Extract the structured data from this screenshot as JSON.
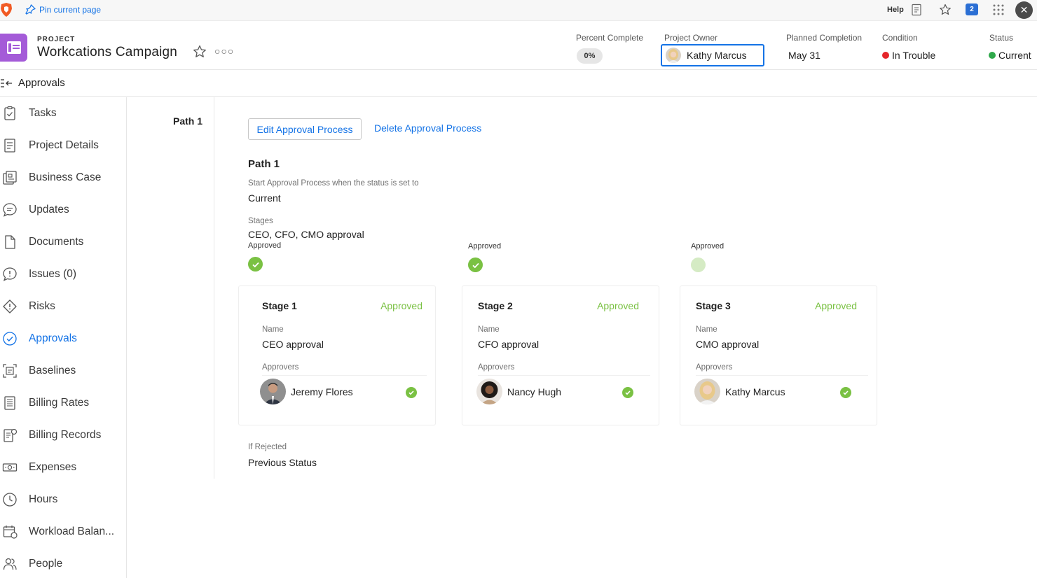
{
  "topbar": {
    "pin_label": "Pin current page",
    "help_label": "Help",
    "notification_count": "2"
  },
  "project": {
    "type_label": "PROJECT",
    "title": "Workcations Campaign",
    "percent_complete": {
      "label": "Percent Complete",
      "value": "0%"
    },
    "owner": {
      "label": "Project Owner",
      "value": "Kathy Marcus"
    },
    "planned_completion": {
      "label": "Planned Completion",
      "value": "May 31"
    },
    "condition": {
      "label": "Condition",
      "value": "In Trouble",
      "color": "#e5262a"
    },
    "status": {
      "label": "Status",
      "value": "Current",
      "color": "#2ea84a"
    }
  },
  "section": {
    "title": "Approvals"
  },
  "sidebar": {
    "items": [
      {
        "label": "Tasks",
        "icon": "clipboard-check-icon"
      },
      {
        "label": "Project Details",
        "icon": "document-lines-icon"
      },
      {
        "label": "Business Case",
        "icon": "business-case-icon"
      },
      {
        "label": "Updates",
        "icon": "chat-bubble-icon"
      },
      {
        "label": "Documents",
        "icon": "file-icon"
      },
      {
        "label": "Issues (0)",
        "icon": "issue-bubble-icon"
      },
      {
        "label": "Risks",
        "icon": "risk-diamond-icon"
      },
      {
        "label": "Approvals",
        "icon": "check-circle-icon",
        "active": true
      },
      {
        "label": "Baselines",
        "icon": "baseline-icon"
      },
      {
        "label": "Billing Rates",
        "icon": "billing-rates-icon"
      },
      {
        "label": "Billing Records",
        "icon": "billing-records-icon"
      },
      {
        "label": "Expenses",
        "icon": "money-icon"
      },
      {
        "label": "Hours",
        "icon": "clock-icon"
      },
      {
        "label": "Workload Balan...",
        "icon": "calendar-balance-icon"
      },
      {
        "label": "People",
        "icon": "people-icon"
      }
    ]
  },
  "path_nav": {
    "label": "Path 1"
  },
  "approval": {
    "edit_label": "Edit Approval Process",
    "delete_label": "Delete Approval Process",
    "path_heading": "Path 1",
    "start_label": "Start Approval Process when the status is set to",
    "start_value": "Current",
    "stages_label": "Stages",
    "stages_value": "CEO, CFO, CMO approval",
    "rejected_label": "If Rejected",
    "rejected_value": "Previous Status",
    "stage_status_labels": [
      "Approved",
      "Approved",
      "Approved"
    ],
    "stages": [
      {
        "title": "Stage 1",
        "status": "Approved",
        "name_label": "Name",
        "name": "CEO approval",
        "approvers_label": "Approvers",
        "approver": "Jeremy Flores"
      },
      {
        "title": "Stage 2",
        "status": "Approved",
        "name_label": "Name",
        "name": "CFO approval",
        "approvers_label": "Approvers",
        "approver": "Nancy Hugh"
      },
      {
        "title": "Stage 3",
        "status": "Approved",
        "name_label": "Name",
        "name": "CMO approval",
        "approvers_label": "Approvers",
        "approver": "Kathy Marcus"
      }
    ]
  },
  "colors": {
    "accent": "#1473e6",
    "approved_green": "#7ac143",
    "project_icon": "#a45bd8"
  }
}
